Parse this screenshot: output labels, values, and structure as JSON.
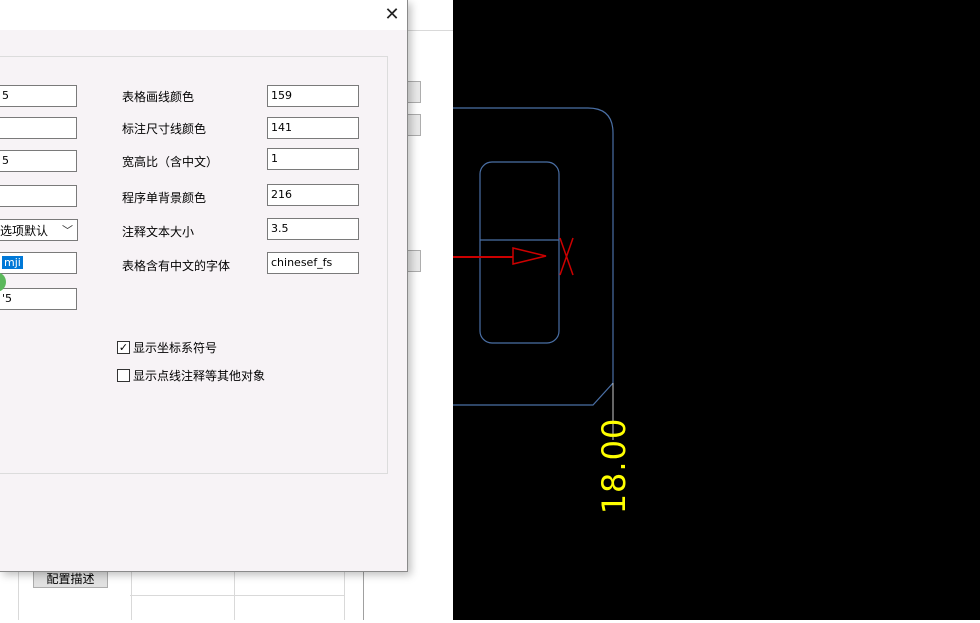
{
  "dialog": {
    "close_glyph": "✕",
    "left_column_values": [
      "5",
      "",
      "5",
      "",
      "",
      "mji",
      "'5"
    ],
    "left_select_value": "选项默认",
    "right_fields": [
      {
        "label": "表格画线颜色",
        "value": "159"
      },
      {
        "label": "标注尺寸线颜色",
        "value": "141"
      },
      {
        "label": "宽高比（含中文）",
        "value": "1"
      },
      {
        "label": "程序单背景颜色",
        "value": "216"
      },
      {
        "label": "注释文本大小",
        "value": "3.5"
      },
      {
        "label": "表格含有中文的字体",
        "value": "chinesef_fs"
      }
    ],
    "checkboxes": [
      {
        "label": "显示坐标系符号",
        "checked": true
      },
      {
        "label": "显示点线注释等其他对象",
        "checked": false
      }
    ]
  },
  "background_app": {
    "config_desc_button": "配置描述"
  },
  "cad": {
    "dimension_text": "18.00",
    "colors": {
      "background": "#000000",
      "outline": "#4a6fa5",
      "arrow": "#cc0000",
      "dimension": "#ffff00"
    }
  }
}
